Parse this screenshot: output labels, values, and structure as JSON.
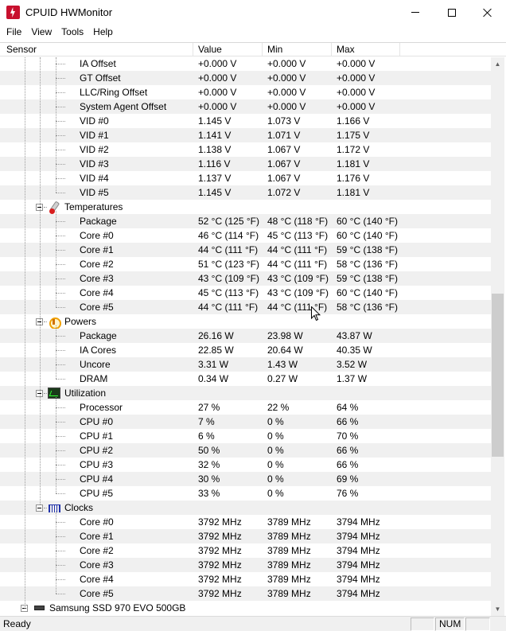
{
  "window": {
    "title": "CPUID HWMonitor"
  },
  "menu": [
    "File",
    "View",
    "Tools",
    "Help"
  ],
  "columns": {
    "sensor": "Sensor",
    "value": "Value",
    "min": "Min",
    "max": "Max"
  },
  "rows": [
    {
      "kind": "item",
      "label": "IA Offset",
      "value": "+0.000 V",
      "min": "+0.000 V",
      "max": "+0.000 V"
    },
    {
      "kind": "item",
      "label": "GT Offset",
      "value": "+0.000 V",
      "min": "+0.000 V",
      "max": "+0.000 V"
    },
    {
      "kind": "item",
      "label": "LLC/Ring Offset",
      "value": "+0.000 V",
      "min": "+0.000 V",
      "max": "+0.000 V"
    },
    {
      "kind": "item",
      "label": "System Agent Offset",
      "value": "+0.000 V",
      "min": "+0.000 V",
      "max": "+0.000 V"
    },
    {
      "kind": "item",
      "label": "VID #0",
      "value": "1.145 V",
      "min": "1.073 V",
      "max": "1.166 V"
    },
    {
      "kind": "item",
      "label": "VID #1",
      "value": "1.141 V",
      "min": "1.071 V",
      "max": "1.175 V"
    },
    {
      "kind": "item",
      "label": "VID #2",
      "value": "1.138 V",
      "min": "1.067 V",
      "max": "1.172 V"
    },
    {
      "kind": "item",
      "label": "VID #3",
      "value": "1.116 V",
      "min": "1.067 V",
      "max": "1.181 V"
    },
    {
      "kind": "item",
      "label": "VID #4",
      "value": "1.137 V",
      "min": "1.067 V",
      "max": "1.176 V"
    },
    {
      "kind": "item",
      "label": "VID #5",
      "value": "1.145 V",
      "min": "1.072 V",
      "max": "1.181 V"
    },
    {
      "kind": "category",
      "label": "Temperatures",
      "icon": "thermometer-icon"
    },
    {
      "kind": "item",
      "label": "Package",
      "value": "52 °C  (125 °F)",
      "min": "48 °C  (118 °F)",
      "max": "60 °C  (140 °F)"
    },
    {
      "kind": "item",
      "label": "Core #0",
      "value": "46 °C  (114 °F)",
      "min": "45 °C  (113 °F)",
      "max": "60 °C  (140 °F)"
    },
    {
      "kind": "item",
      "label": "Core #1",
      "value": "44 °C  (111 °F)",
      "min": "44 °C  (111 °F)",
      "max": "59 °C  (138 °F)"
    },
    {
      "kind": "item",
      "label": "Core #2",
      "value": "51 °C  (123 °F)",
      "min": "44 °C  (111 °F)",
      "max": "58 °C  (136 °F)"
    },
    {
      "kind": "item",
      "label": "Core #3",
      "value": "43 °C  (109 °F)",
      "min": "43 °C  (109 °F)",
      "max": "59 °C  (138 °F)"
    },
    {
      "kind": "item",
      "label": "Core #4",
      "value": "45 °C  (113 °F)",
      "min": "43 °C  (109 °F)",
      "max": "60 °C  (140 °F)"
    },
    {
      "kind": "item",
      "label": "Core #5",
      "value": "44 °C  (111 °F)",
      "min": "44 °C  (111 °F)",
      "max": "58 °C  (136 °F)"
    },
    {
      "kind": "category",
      "label": "Powers",
      "icon": "power-icon"
    },
    {
      "kind": "item",
      "label": "Package",
      "value": "26.16 W",
      "min": "23.98 W",
      "max": "43.87 W"
    },
    {
      "kind": "item",
      "label": "IA Cores",
      "value": "22.85 W",
      "min": "20.64 W",
      "max": "40.35 W"
    },
    {
      "kind": "item",
      "label": "Uncore",
      "value": "3.31 W",
      "min": "1.43 W",
      "max": "3.52 W"
    },
    {
      "kind": "item",
      "label": "DRAM",
      "value": "0.34 W",
      "min": "0.27 W",
      "max": "1.37 W"
    },
    {
      "kind": "category",
      "label": "Utilization",
      "icon": "utilization-icon"
    },
    {
      "kind": "item",
      "label": "Processor",
      "value": "27 %",
      "min": "22 %",
      "max": "64 %"
    },
    {
      "kind": "item",
      "label": "CPU #0",
      "value": "7 %",
      "min": "0 %",
      "max": "66 %"
    },
    {
      "kind": "item",
      "label": "CPU #1",
      "value": "6 %",
      "min": "0 %",
      "max": "70 %"
    },
    {
      "kind": "item",
      "label": "CPU #2",
      "value": "50 %",
      "min": "0 %",
      "max": "66 %"
    },
    {
      "kind": "item",
      "label": "CPU #3",
      "value": "32 %",
      "min": "0 %",
      "max": "66 %"
    },
    {
      "kind": "item",
      "label": "CPU #4",
      "value": "30 %",
      "min": "0 %",
      "max": "69 %"
    },
    {
      "kind": "item",
      "label": "CPU #5",
      "value": "33 %",
      "min": "0 %",
      "max": "76 %"
    },
    {
      "kind": "category",
      "label": "Clocks",
      "icon": "clock-icon"
    },
    {
      "kind": "item",
      "label": "Core #0",
      "value": "3792 MHz",
      "min": "3789 MHz",
      "max": "3794 MHz"
    },
    {
      "kind": "item",
      "label": "Core #1",
      "value": "3792 MHz",
      "min": "3789 MHz",
      "max": "3794 MHz"
    },
    {
      "kind": "item",
      "label": "Core #2",
      "value": "3792 MHz",
      "min": "3789 MHz",
      "max": "3794 MHz"
    },
    {
      "kind": "item",
      "label": "Core #3",
      "value": "3792 MHz",
      "min": "3789 MHz",
      "max": "3794 MHz"
    },
    {
      "kind": "item",
      "label": "Core #4",
      "value": "3792 MHz",
      "min": "3789 MHz",
      "max": "3794 MHz"
    },
    {
      "kind": "item",
      "label": "Core #5",
      "value": "3792 MHz",
      "min": "3789 MHz",
      "max": "3794 MHz"
    },
    {
      "kind": "device",
      "label": "Samsung SSD 970 EVO 500GB",
      "icon": "ssd-icon"
    }
  ],
  "statusbar": {
    "text": "Ready",
    "num": "NUM"
  }
}
